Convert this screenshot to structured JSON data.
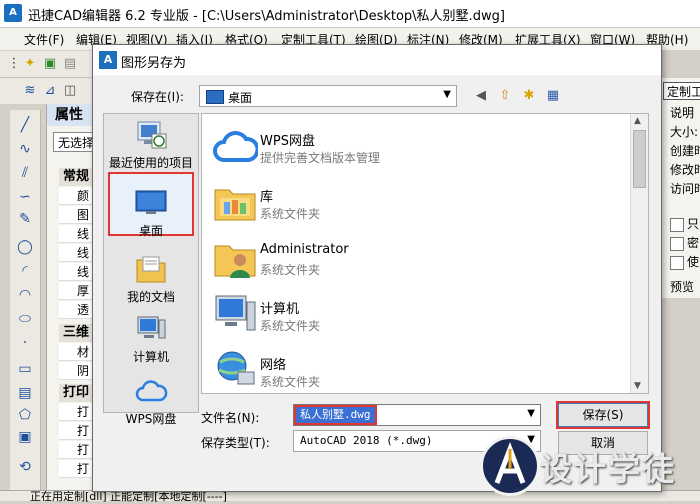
{
  "app": {
    "title": "迅捷CAD编辑器 6.2 专业版 - [C:\\Users\\Administrator\\Desktop\\私人别墅.dwg]",
    "icon_letters": "A"
  },
  "menubar": {
    "items": [
      "文件(F)",
      "编辑(E)",
      "视图(V)",
      "插入(I)",
      "格式(O)",
      "定制工具(T)",
      "绘图(D)",
      "标注(N)",
      "修改(M)",
      "扩展工具(X)",
      "窗口(W)",
      "帮助(H)"
    ]
  },
  "props": {
    "title": "属性",
    "selection": "无选择",
    "groups": [
      {
        "label": "常规",
        "rows": [
          "颜",
          "图",
          "线",
          "线",
          "线",
          "厚",
          "透"
        ]
      },
      {
        "label": "三维",
        "rows": [
          "材",
          "阴"
        ]
      },
      {
        "label": "打印",
        "rows": [
          "打",
          "打",
          "打",
          "打"
        ]
      }
    ]
  },
  "rightpanel": {
    "button": "定制工",
    "labels": [
      "说明",
      "大小:",
      "创建时",
      "修改时",
      "访问时"
    ],
    "checks": [
      "只",
      "密",
      "使"
    ],
    "preview": "预览"
  },
  "statusbar": {
    "text": "正在用定制[dll] 正能定制[本地定制[----]"
  },
  "dialog": {
    "title": "图形另存为",
    "savein_label": "保存在(I):",
    "savein_value": "桌面",
    "places": [
      {
        "label": "最近使用的项目",
        "icon": "recent-icon"
      },
      {
        "label": "桌面",
        "icon": "desktop-icon"
      },
      {
        "label": "我的文档",
        "icon": "documents-icon"
      },
      {
        "label": "计算机",
        "icon": "computer-icon"
      },
      {
        "label": "WPS网盘",
        "icon": "cloud-icon"
      }
    ],
    "files": [
      {
        "name": "WPS网盘",
        "desc": "提供完善文档版本管理",
        "icon": "cloud-icon"
      },
      {
        "name": "库",
        "desc": "系统文件夹",
        "icon": "library-icon"
      },
      {
        "name": "Administrator",
        "desc": "系统文件夹",
        "icon": "user-folder-icon"
      },
      {
        "name": "计算机",
        "desc": "系统文件夹",
        "icon": "computer-icon"
      },
      {
        "name": "网络",
        "desc": "系统文件夹",
        "icon": "network-icon"
      }
    ],
    "filename_label": "文件名(N):",
    "filename_value": "私人别墅.dwg",
    "filetype_label": "保存类型(T):",
    "filetype_value": "AutoCAD 2018 (*.dwg)",
    "save_button": "保存(S)",
    "cancel_button": "取消"
  },
  "watermark": {
    "text": "设计学徒"
  },
  "colors": {
    "accent": "#3a6fd3",
    "highlight_box": "#e43535",
    "title_blue": "#1c6fbc"
  }
}
